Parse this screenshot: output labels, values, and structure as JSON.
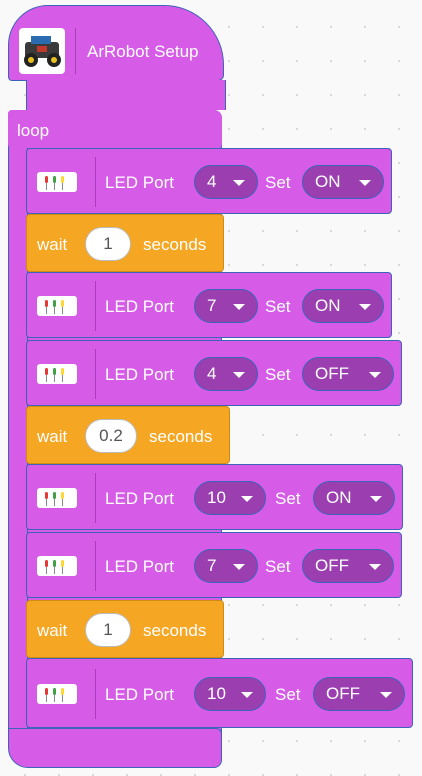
{
  "setup": {
    "label": "ArRobot Setup"
  },
  "loop": {
    "label": "loop"
  },
  "led_label": "LED Port",
  "set_label": "Set",
  "wait_label": "wait",
  "seconds_label": "seconds",
  "colors": {
    "block_purple": "#d65ce8",
    "block_orange": "#f5a623",
    "dropdown": "#9b3fb0",
    "outline": "#3d63b8"
  },
  "blocks": [
    {
      "type": "led",
      "port": "4",
      "state": "ON"
    },
    {
      "type": "wait",
      "seconds": "1"
    },
    {
      "type": "led",
      "port": "7",
      "state": "ON"
    },
    {
      "type": "led",
      "port": "4",
      "state": "OFF"
    },
    {
      "type": "wait",
      "seconds": "0.2"
    },
    {
      "type": "led",
      "port": "10",
      "state": "ON"
    },
    {
      "type": "led",
      "port": "7",
      "state": "OFF"
    },
    {
      "type": "wait",
      "seconds": "1"
    },
    {
      "type": "led",
      "port": "10",
      "state": "OFF"
    }
  ]
}
